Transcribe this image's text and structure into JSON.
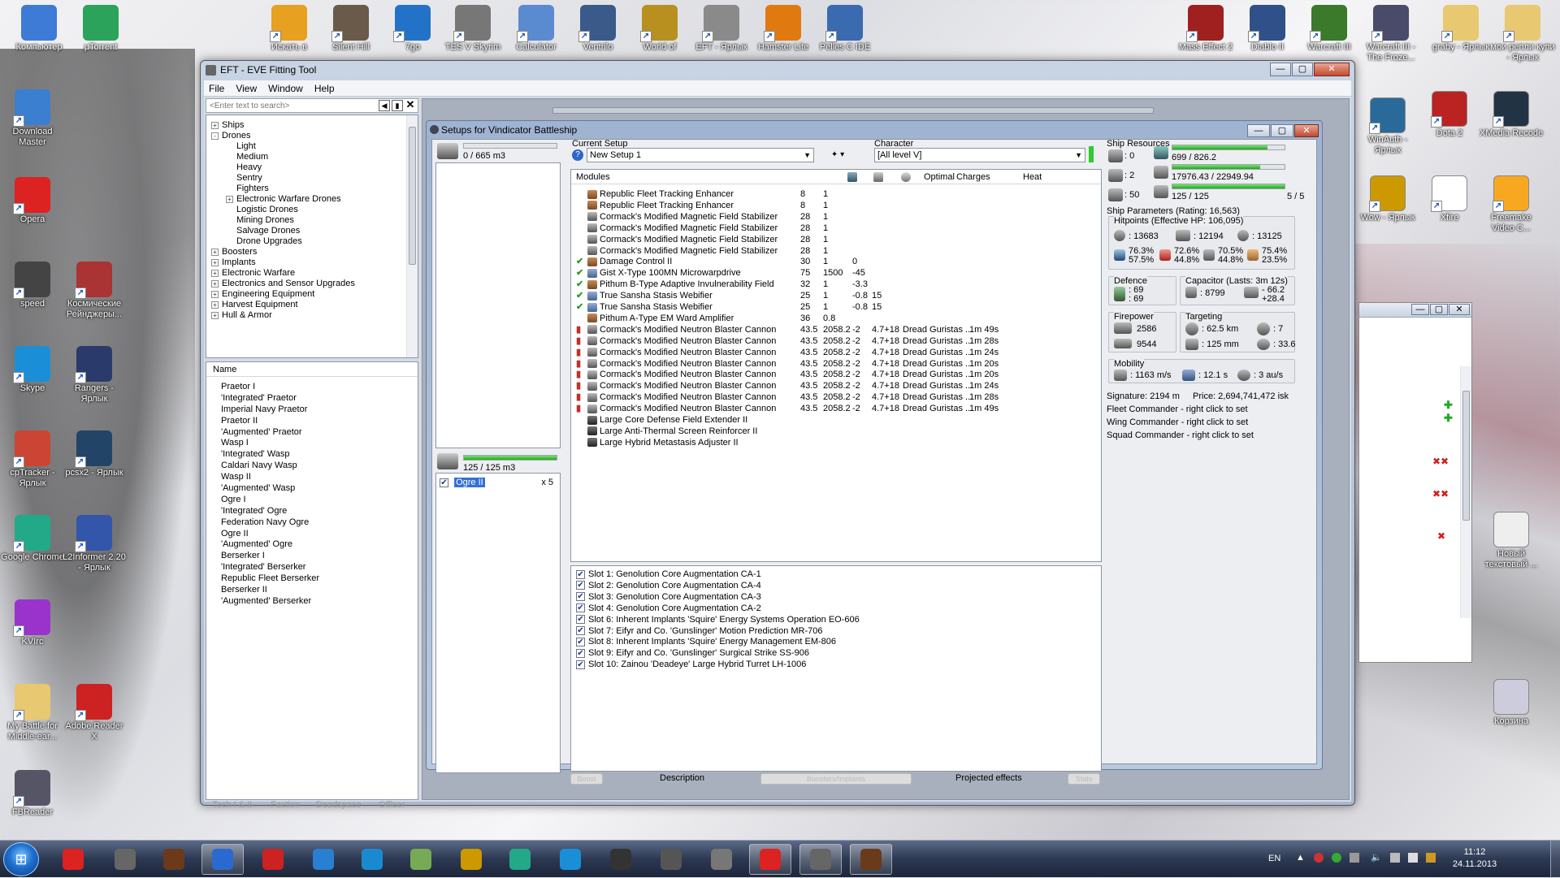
{
  "desktop": {
    "top_icons": [
      {
        "label": "Компьютер",
        "name": "computer"
      },
      {
        "label": "µTorrent",
        "name": "utorrent"
      },
      {
        "label": "Искать в",
        "name": "search-in"
      },
      {
        "label": "Silent Hill",
        "name": "silent-hill"
      },
      {
        "label": "7go",
        "name": "7go"
      },
      {
        "label": "TES V Skyrim",
        "name": "skyrim"
      },
      {
        "label": "Calculator",
        "name": "calculator"
      },
      {
        "label": "Ventrilo",
        "name": "ventrilo"
      },
      {
        "label": "World of",
        "name": "world-of"
      },
      {
        "label": "EFT - Ярлык",
        "name": "eft-shortcut"
      },
      {
        "label": "Hamster Lite",
        "name": "hamster-lite"
      },
      {
        "label": "Pelles C IDE",
        "name": "pelles-c-ide"
      },
      {
        "label": "Mass Effect 2",
        "name": "mass-effect-2"
      },
      {
        "label": "Diablo II",
        "name": "diablo-2"
      },
      {
        "label": "Warcraft III",
        "name": "warcraft-3"
      },
      {
        "label": "Warcraft III - The Froze...",
        "name": "warcraft-3-frozen"
      },
      {
        "label": "graby - Ярлык",
        "name": "graby"
      },
      {
        "label": "мои репли купи - Ярлык",
        "name": "my-replies"
      }
    ],
    "left_icons": [
      {
        "label": "Download Master",
        "name": "download-master"
      },
      {
        "label": "Opera",
        "name": "opera"
      },
      {
        "label": "speed",
        "name": "speed"
      },
      {
        "label": "Космические Рейнджеры...",
        "name": "space-rangers"
      },
      {
        "label": "Skype",
        "name": "skype"
      },
      {
        "label": "Rangers - Ярлык",
        "name": "rangers"
      },
      {
        "label": "cpTracker - Ярлык",
        "name": "cptracker"
      },
      {
        "label": "pcsx2 - Ярлык",
        "name": "pcsx2"
      },
      {
        "label": "Google Chrome",
        "name": "google-chrome"
      },
      {
        "label": "L2Informer 2.20 - Ярлык",
        "name": "l2informer"
      },
      {
        "label": "KVIrc",
        "name": "kvirc"
      },
      {
        "label": "My Battle for Middle-ear...",
        "name": "battle-middle-earth"
      },
      {
        "label": "Adobe Reader X",
        "name": "adobe-reader"
      },
      {
        "label": "FBReader",
        "name": "fbreader"
      }
    ],
    "right_icons": [
      {
        "label": "WinAuth - Ярлык",
        "name": "winauth"
      },
      {
        "label": "Dota 2",
        "name": "dota-2"
      },
      {
        "label": "XMedia Recode",
        "name": "xmedia-recode"
      },
      {
        "label": "Wow - Ярлык",
        "name": "wow"
      },
      {
        "label": "Xfire",
        "name": "xfire"
      },
      {
        "label": "Freemake Video C...",
        "name": "freemake"
      },
      {
        "label": "Новый текстовый ...",
        "name": "new-text-doc"
      },
      {
        "label": "Корзина",
        "name": "recycle-bin"
      }
    ]
  },
  "eft": {
    "title": "EFT - EVE Fitting Tool",
    "menu": [
      "File",
      "View",
      "Window",
      "Help"
    ],
    "search_placeholder": "<Enter text to search>",
    "tree": [
      {
        "label": "Ships",
        "depth": 0,
        "expander": "+"
      },
      {
        "label": "Drones",
        "depth": 0,
        "expander": "-"
      },
      {
        "label": "Light",
        "depth": 1,
        "expander": ""
      },
      {
        "label": "Medium",
        "depth": 1,
        "expander": ""
      },
      {
        "label": "Heavy",
        "depth": 1,
        "expander": ""
      },
      {
        "label": "Sentry",
        "depth": 1,
        "expander": ""
      },
      {
        "label": "Fighters",
        "depth": 1,
        "expander": ""
      },
      {
        "label": "Electronic Warfare Drones",
        "depth": 1,
        "expander": "+"
      },
      {
        "label": "Logistic Drones",
        "depth": 1,
        "expander": ""
      },
      {
        "label": "Mining Drones",
        "depth": 1,
        "expander": ""
      },
      {
        "label": "Salvage Drones",
        "depth": 1,
        "expander": ""
      },
      {
        "label": "Drone Upgrades",
        "depth": 1,
        "expander": ""
      },
      {
        "label": "Boosters",
        "depth": 0,
        "expander": "+"
      },
      {
        "label": "Implants",
        "depth": 0,
        "expander": "+"
      },
      {
        "label": "Electronic Warfare",
        "depth": 0,
        "expander": "+"
      },
      {
        "label": "Electronics and Sensor Upgrades",
        "depth": 0,
        "expander": "+"
      },
      {
        "label": "Engineering Equipment",
        "depth": 0,
        "expander": "+"
      },
      {
        "label": "Harvest Equipment",
        "depth": 0,
        "expander": "+"
      },
      {
        "label": "Hull & Armor",
        "depth": 0,
        "expander": "+"
      }
    ],
    "list_header": "Name",
    "list_items": [
      "Praetor I",
      "'Integrated' Praetor",
      "Imperial Navy Praetor",
      "Praetor II",
      "'Augmented' Praetor",
      "Wasp I",
      "'Integrated' Wasp",
      "Caldari Navy Wasp",
      "Wasp II",
      "'Augmented' Wasp",
      "Ogre I",
      "'Integrated' Ogre",
      "Federation Navy Ogre",
      "Ogre II",
      "'Augmented' Ogre",
      "Berserker I",
      "'Integrated' Berserker",
      "Republic Fleet Berserker",
      "Berserker II",
      "'Augmented' Berserker"
    ],
    "bottom_tabs": [
      "Tech I & II",
      "Faction",
      "Deadspace",
      "Officer"
    ]
  },
  "setup": {
    "title": "Setups for Vindicator Battleship",
    "cargo": "0 / 665 m3",
    "drone_bay": "125 / 125 m3",
    "drone_bay_fill": 1.0,
    "drone_name": "Ogre II",
    "drone_count": "x 5",
    "current_setup_label": "Current Setup",
    "current_setup_value": "New Setup 1",
    "character_label": "Character",
    "character_value": "[All level V]",
    "modules_header": {
      "name": "Modules",
      "optimal": "Optimal",
      "charges": "Charges",
      "heat": "Heat"
    },
    "modules": [
      {
        "state": "",
        "icon": "brown",
        "name": "Republic Fleet Tracking Enhancer",
        "cpu": "8",
        "pg": "1",
        "cap": "",
        "opt": "",
        "charges": "",
        "heat": ""
      },
      {
        "state": "",
        "icon": "brown",
        "name": "Republic Fleet Tracking Enhancer",
        "cpu": "8",
        "pg": "1",
        "cap": "",
        "opt": "",
        "charges": "",
        "heat": ""
      },
      {
        "state": "",
        "icon": "gray",
        "name": "Cormack's Modified Magnetic Field Stabilizer",
        "cpu": "28",
        "pg": "1",
        "cap": "",
        "opt": "",
        "charges": "",
        "heat": ""
      },
      {
        "state": "",
        "icon": "gray",
        "name": "Cormack's Modified Magnetic Field Stabilizer",
        "cpu": "28",
        "pg": "1",
        "cap": "",
        "opt": "",
        "charges": "",
        "heat": ""
      },
      {
        "state": "",
        "icon": "gray",
        "name": "Cormack's Modified Magnetic Field Stabilizer",
        "cpu": "28",
        "pg": "1",
        "cap": "",
        "opt": "",
        "charges": "",
        "heat": ""
      },
      {
        "state": "",
        "icon": "gray",
        "name": "Cormack's Modified Magnetic Field Stabilizer",
        "cpu": "28",
        "pg": "1",
        "cap": "",
        "opt": "",
        "charges": "",
        "heat": ""
      },
      {
        "state": "✔",
        "icon": "brown",
        "name": "Damage Control II",
        "cpu": "30",
        "pg": "1",
        "cap": "0",
        "opt": "",
        "charges": "",
        "heat": ""
      },
      {
        "state": "✔",
        "icon": "blue",
        "name": "Gist X-Type 100MN Microwarpdrive",
        "cpu": "75",
        "pg": "1500",
        "cap": "-45",
        "opt": "",
        "charges": "",
        "heat": ""
      },
      {
        "state": "✔",
        "icon": "brown",
        "name": "Pithum B-Type Adaptive Invulnerability Field",
        "cpu": "32",
        "pg": "1",
        "cap": "-3.3",
        "opt": "",
        "charges": "",
        "heat": ""
      },
      {
        "state": "✔",
        "icon": "blue",
        "name": "True Sansha Stasis Webifier",
        "cpu": "25",
        "pg": "1",
        "cap": "-0.8",
        "opt": "15",
        "charges": "",
        "heat": ""
      },
      {
        "state": "✔",
        "icon": "blue",
        "name": "True Sansha Stasis Webifier",
        "cpu": "25",
        "pg": "1",
        "cap": "-0.8",
        "opt": "15",
        "charges": "",
        "heat": ""
      },
      {
        "state": "",
        "icon": "brown",
        "name": "Pithum A-Type EM Ward Amplifier",
        "cpu": "36",
        "pg": "0.8",
        "cap": "",
        "opt": "",
        "charges": "",
        "heat": ""
      },
      {
        "state": "red",
        "icon": "gray",
        "name": "Cormack's Modified Neutron Blaster Cannon",
        "cpu": "43.5",
        "pg": "2058.2",
        "cap": "-2",
        "opt": "4.7+18",
        "charges": "Dread Guristas ...",
        "heat": "1m 49s"
      },
      {
        "state": "red",
        "icon": "gray",
        "name": "Cormack's Modified Neutron Blaster Cannon",
        "cpu": "43.5",
        "pg": "2058.2",
        "cap": "-2",
        "opt": "4.7+18",
        "charges": "Dread Guristas ...",
        "heat": "1m 28s"
      },
      {
        "state": "red",
        "icon": "gray",
        "name": "Cormack's Modified Neutron Blaster Cannon",
        "cpu": "43.5",
        "pg": "2058.2",
        "cap": "-2",
        "opt": "4.7+18",
        "charges": "Dread Guristas ...",
        "heat": "1m 24s"
      },
      {
        "state": "red",
        "icon": "gray",
        "name": "Cormack's Modified Neutron Blaster Cannon",
        "cpu": "43.5",
        "pg": "2058.2",
        "cap": "-2",
        "opt": "4.7+18",
        "charges": "Dread Guristas ...",
        "heat": "1m 20s"
      },
      {
        "state": "red",
        "icon": "gray",
        "name": "Cormack's Modified Neutron Blaster Cannon",
        "cpu": "43.5",
        "pg": "2058.2",
        "cap": "-2",
        "opt": "4.7+18",
        "charges": "Dread Guristas ...",
        "heat": "1m 20s"
      },
      {
        "state": "red",
        "icon": "gray",
        "name": "Cormack's Modified Neutron Blaster Cannon",
        "cpu": "43.5",
        "pg": "2058.2",
        "cap": "-2",
        "opt": "4.7+18",
        "charges": "Dread Guristas ...",
        "heat": "1m 24s"
      },
      {
        "state": "red",
        "icon": "gray",
        "name": "Cormack's Modified Neutron Blaster Cannon",
        "cpu": "43.5",
        "pg": "2058.2",
        "cap": "-2",
        "opt": "4.7+18",
        "charges": "Dread Guristas ...",
        "heat": "1m 28s"
      },
      {
        "state": "red",
        "icon": "gray",
        "name": "Cormack's Modified Neutron Blaster Cannon",
        "cpu": "43.5",
        "pg": "2058.2",
        "cap": "-2",
        "opt": "4.7+18",
        "charges": "Dread Guristas ...",
        "heat": "1m 49s"
      },
      {
        "state": "",
        "icon": "dark",
        "name": "Large Core Defense Field Extender II",
        "cpu": "",
        "pg": "",
        "cap": "",
        "opt": "",
        "charges": "",
        "heat": ""
      },
      {
        "state": "",
        "icon": "dark",
        "name": "Large Anti-Thermal Screen Reinforcer II",
        "cpu": "",
        "pg": "",
        "cap": "",
        "opt": "",
        "charges": "",
        "heat": ""
      },
      {
        "state": "",
        "icon": "dark",
        "name": "Large Hybrid Metastasis Adjuster II",
        "cpu": "",
        "pg": "",
        "cap": "",
        "opt": "",
        "charges": "",
        "heat": ""
      }
    ],
    "implants": [
      "Slot 1: Genolution Core Augmentation CA-1",
      "Slot 2: Genolution Core Augmentation CA-4",
      "Slot 3: Genolution Core Augmentation CA-3",
      "Slot 4: Genolution Core Augmentation CA-2",
      "Slot 6: Inherent Implants 'Squire' Energy Systems Operation EO-606",
      "Slot 7: Eifyr and Co. 'Gunslinger' Motion Prediction MR-706",
      "Slot 8: Inherent Implants 'Squire' Energy Management EM-806",
      "Slot 9: Eifyr and Co. 'Gunslinger' Surgical Strike SS-906",
      "Slot 10: Zainou 'Deadeye' Large Hybrid Turret LH-1006"
    ],
    "bottom_tabs": {
      "boost": "Boost",
      "description": "Description",
      "boosters": "Boosters/Implants",
      "projected": "Projected effects",
      "stats": "Stats"
    },
    "resources": {
      "title": "Ship Resources",
      "hi_free": ": 0",
      "med_free": ": 2",
      "low_free": ": 50",
      "cpu": "699 / 826.2",
      "cpu_fill": 0.85,
      "pg": "17976.43 / 22949.94",
      "pg_fill": 0.78,
      "drone_bw": "125 / 125",
      "drone_bw_fill": 1.0,
      "drones_active": "5 / 5"
    },
    "params": {
      "title": "Ship Parameters (Rating: 16,563)",
      "hitpoints": "Hitpoints (Effective HP: 106,095)",
      "shield_hp": ": 13683",
      "armor_hp": ": 12194",
      "hull_hp": ": 13125",
      "shield_res": [
        "76.3%",
        "57.5%"
      ],
      "armor_res": [
        "72.6%",
        "44.8%"
      ],
      "hull_res": [
        "70.5%",
        "44.8%"
      ],
      "extra_res": [
        "75.4%",
        "23.5%"
      ],
      "defence_title": "Defence",
      "def_a": ": 69",
      "def_b": ": 69",
      "capacitor_title": "Capacitor (Lasts: 3m 12s)",
      "cap_amount": ": 8799",
      "cap_delta": "- 66.2",
      "cap_regen": "+28.4",
      "firepower_title": "Firepower",
      "dps": "2586",
      "volley": "9544",
      "targeting_title": "Targeting",
      "range": ": 62.5 km",
      "max_targets": ": 7",
      "scan_res": ": 125 mm",
      "sensor": ": 33.6",
      "mobility_title": "Mobility",
      "speed": ": 1163 m/s",
      "align": ": 12.1 s",
      "warp": ": 3 au/s",
      "signature": "Signature: 2194 m",
      "price": "Price: 2,694,741,472 isk",
      "fleet_cmd": "Fleet Commander - right click to set",
      "wing_cmd": "Wing Commander - right click to set",
      "squad_cmd": "Squad Commander - right click to set"
    }
  },
  "taskbar": {
    "lang": "EN",
    "time": "11:12",
    "date": "24.11.2013"
  }
}
